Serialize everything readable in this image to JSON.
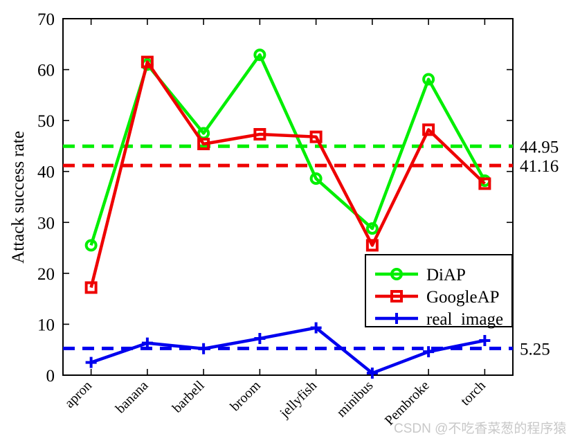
{
  "chart_data": {
    "type": "line",
    "title": "",
    "xlabel": "",
    "ylabel": "Attack success rate",
    "categories": [
      "apron",
      "banana",
      "barbell",
      "broom",
      "jellyfish",
      "minibus",
      "Pembroke",
      "torch"
    ],
    "ylim": [
      0,
      70
    ],
    "yticks": [
      0,
      10,
      20,
      30,
      40,
      50,
      60,
      70
    ],
    "grid": false,
    "legend_position": "lower right",
    "series": [
      {
        "name": "DiAP",
        "color": "#00ee00",
        "marker": "circle",
        "values": [
          25.5,
          61.0,
          47.5,
          62.9,
          38.6,
          28.8,
          58.1,
          38.2
        ]
      },
      {
        "name": "GoogleAP",
        "color": "#ee0000",
        "marker": "square",
        "values": [
          17.2,
          61.5,
          45.4,
          47.3,
          46.8,
          25.5,
          48.2,
          37.6
        ]
      },
      {
        "name": "real_image",
        "color": "#0000ee",
        "marker": "plus",
        "values": [
          2.5,
          6.3,
          5.2,
          7.2,
          9.3,
          0.4,
          4.6,
          6.8
        ]
      }
    ],
    "reference_lines": [
      {
        "name": "DiAP mean",
        "value": 44.95,
        "label": "44.95",
        "color": "#00ee00",
        "style": "dashed"
      },
      {
        "name": "GoogleAP mean",
        "value": 41.16,
        "label": "41.16",
        "color": "#ee0000",
        "style": "dashed"
      },
      {
        "name": "real_image mean",
        "value": 5.25,
        "label": "5.25",
        "color": "#0000ee",
        "style": "dashed"
      }
    ]
  },
  "axes": {
    "y_title": "Attack success rate",
    "y_tick_labels": [
      "0",
      "10",
      "20",
      "30",
      "40",
      "50",
      "60",
      "70"
    ],
    "x_tick_labels": [
      "apron",
      "banana",
      "barbell",
      "broom",
      "jellyfish",
      "minibus",
      "Pembroke",
      "torch"
    ]
  },
  "legend": {
    "items": [
      {
        "label": "DiAP",
        "color": "#00ee00",
        "marker": "circle"
      },
      {
        "label": "GoogleAP",
        "color": "#ee0000",
        "marker": "square"
      },
      {
        "label": "real_image",
        "color": "#0000ee",
        "marker": "plus"
      }
    ]
  },
  "annotations": {
    "green_value": "44.95",
    "red_value": "41.16",
    "blue_value": "5.25"
  },
  "watermark": {
    "text": "CSDN @不吃香菜葱的程序猿"
  }
}
